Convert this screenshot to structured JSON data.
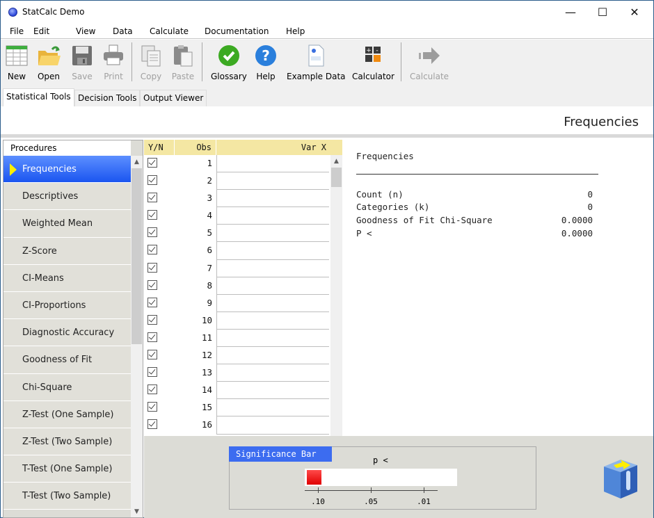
{
  "window": {
    "title": "StatCalc Demo",
    "controls": {
      "minimize": "—",
      "maximize": "☐",
      "close": "✕"
    }
  },
  "menu": [
    "File",
    "Edit",
    "View",
    "Data",
    "Calculate",
    "Documentation",
    "Help"
  ],
  "toolbar": {
    "new": "New",
    "open": "Open",
    "save": "Save",
    "print": "Print",
    "copy": "Copy",
    "paste": "Paste",
    "glossary": "Glossary",
    "help": "Help",
    "example_data": "Example Data",
    "calculator": "Calculator",
    "calculate": "Calculate"
  },
  "tabs": [
    "Statistical Tools",
    "Decision Tools",
    "Output Viewer"
  ],
  "active_tab": "Statistical Tools",
  "header_title": "Frequencies",
  "procedures": {
    "header": "Procedures",
    "items": [
      "Frequencies",
      "Descriptives",
      "Weighted Mean",
      "Z-Score",
      "CI-Means",
      "CI-Proportions",
      "Diagnostic Accuracy",
      "Goodness of Fit",
      "Chi-Square",
      "Z-Test (One Sample)",
      "Z-Test (Two Sample)",
      "T-Test (One Sample)",
      "T-Test (Two Sample)"
    ],
    "selected": "Frequencies"
  },
  "grid": {
    "headers": {
      "yn": "Y/N",
      "obs": "Obs",
      "var": "Var X"
    },
    "rows": [
      {
        "checked": true,
        "obs": "1",
        "value": ""
      },
      {
        "checked": true,
        "obs": "2",
        "value": ""
      },
      {
        "checked": true,
        "obs": "3",
        "value": ""
      },
      {
        "checked": true,
        "obs": "4",
        "value": ""
      },
      {
        "checked": true,
        "obs": "5",
        "value": ""
      },
      {
        "checked": true,
        "obs": "6",
        "value": ""
      },
      {
        "checked": true,
        "obs": "7",
        "value": ""
      },
      {
        "checked": true,
        "obs": "8",
        "value": ""
      },
      {
        "checked": true,
        "obs": "9",
        "value": ""
      },
      {
        "checked": true,
        "obs": "10",
        "value": ""
      },
      {
        "checked": true,
        "obs": "11",
        "value": ""
      },
      {
        "checked": true,
        "obs": "12",
        "value": ""
      },
      {
        "checked": true,
        "obs": "13",
        "value": ""
      },
      {
        "checked": true,
        "obs": "14",
        "value": ""
      },
      {
        "checked": true,
        "obs": "15",
        "value": ""
      },
      {
        "checked": true,
        "obs": "16",
        "value": ""
      }
    ]
  },
  "output": {
    "title": "Frequencies",
    "rows": [
      {
        "label": "Count (n)",
        "value": "0"
      },
      {
        "label": "Categories (k)",
        "value": "0"
      },
      {
        "label": "Goodness of Fit Chi-Square",
        "value": "0.0000"
      },
      {
        "label": "P <",
        "value": "0.0000"
      }
    ]
  },
  "significance_bar": {
    "title": "Significance Bar",
    "label": "p <",
    "ticks": [
      ".10",
      ".05",
      ".01"
    ],
    "fill_fraction": 0.1,
    "fill_color": "#e00000"
  },
  "colors": {
    "accent": "#3c6cf0",
    "selected_procedure": "#1b55f0",
    "grid_header": "#f4e7a3",
    "panel_bg": "#dcdcd6"
  }
}
